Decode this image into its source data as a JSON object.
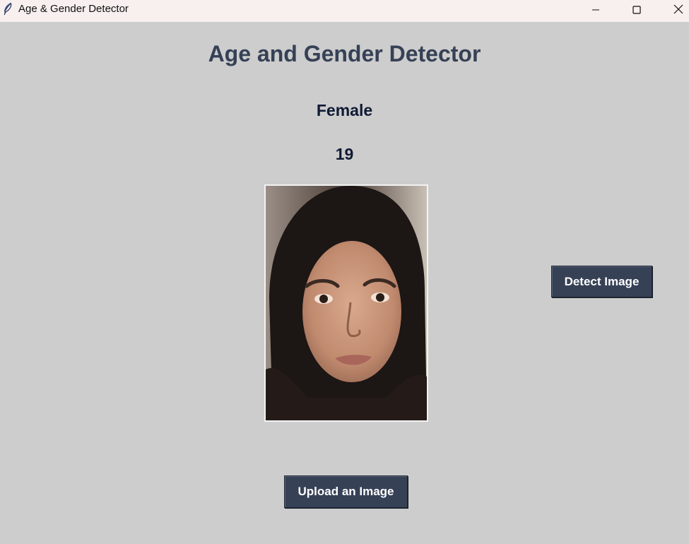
{
  "window": {
    "title": "Age & Gender Detector",
    "controls": [
      "minimize-icon",
      "maximize-icon",
      "close-icon"
    ]
  },
  "main": {
    "heading": "Age and Gender Detector",
    "gender_result": "Female",
    "age_result": "19",
    "photo_icon": "face-photo"
  },
  "buttons": {
    "detect_label": "Detect Image",
    "upload_label": "Upload an Image"
  },
  "colors": {
    "background": "#cdcdcd",
    "heading": "#364156",
    "button_bg": "#364156",
    "button_text": "#ffffff",
    "result_text": "#0f1a34",
    "titlebar": "#f7f0ee"
  }
}
